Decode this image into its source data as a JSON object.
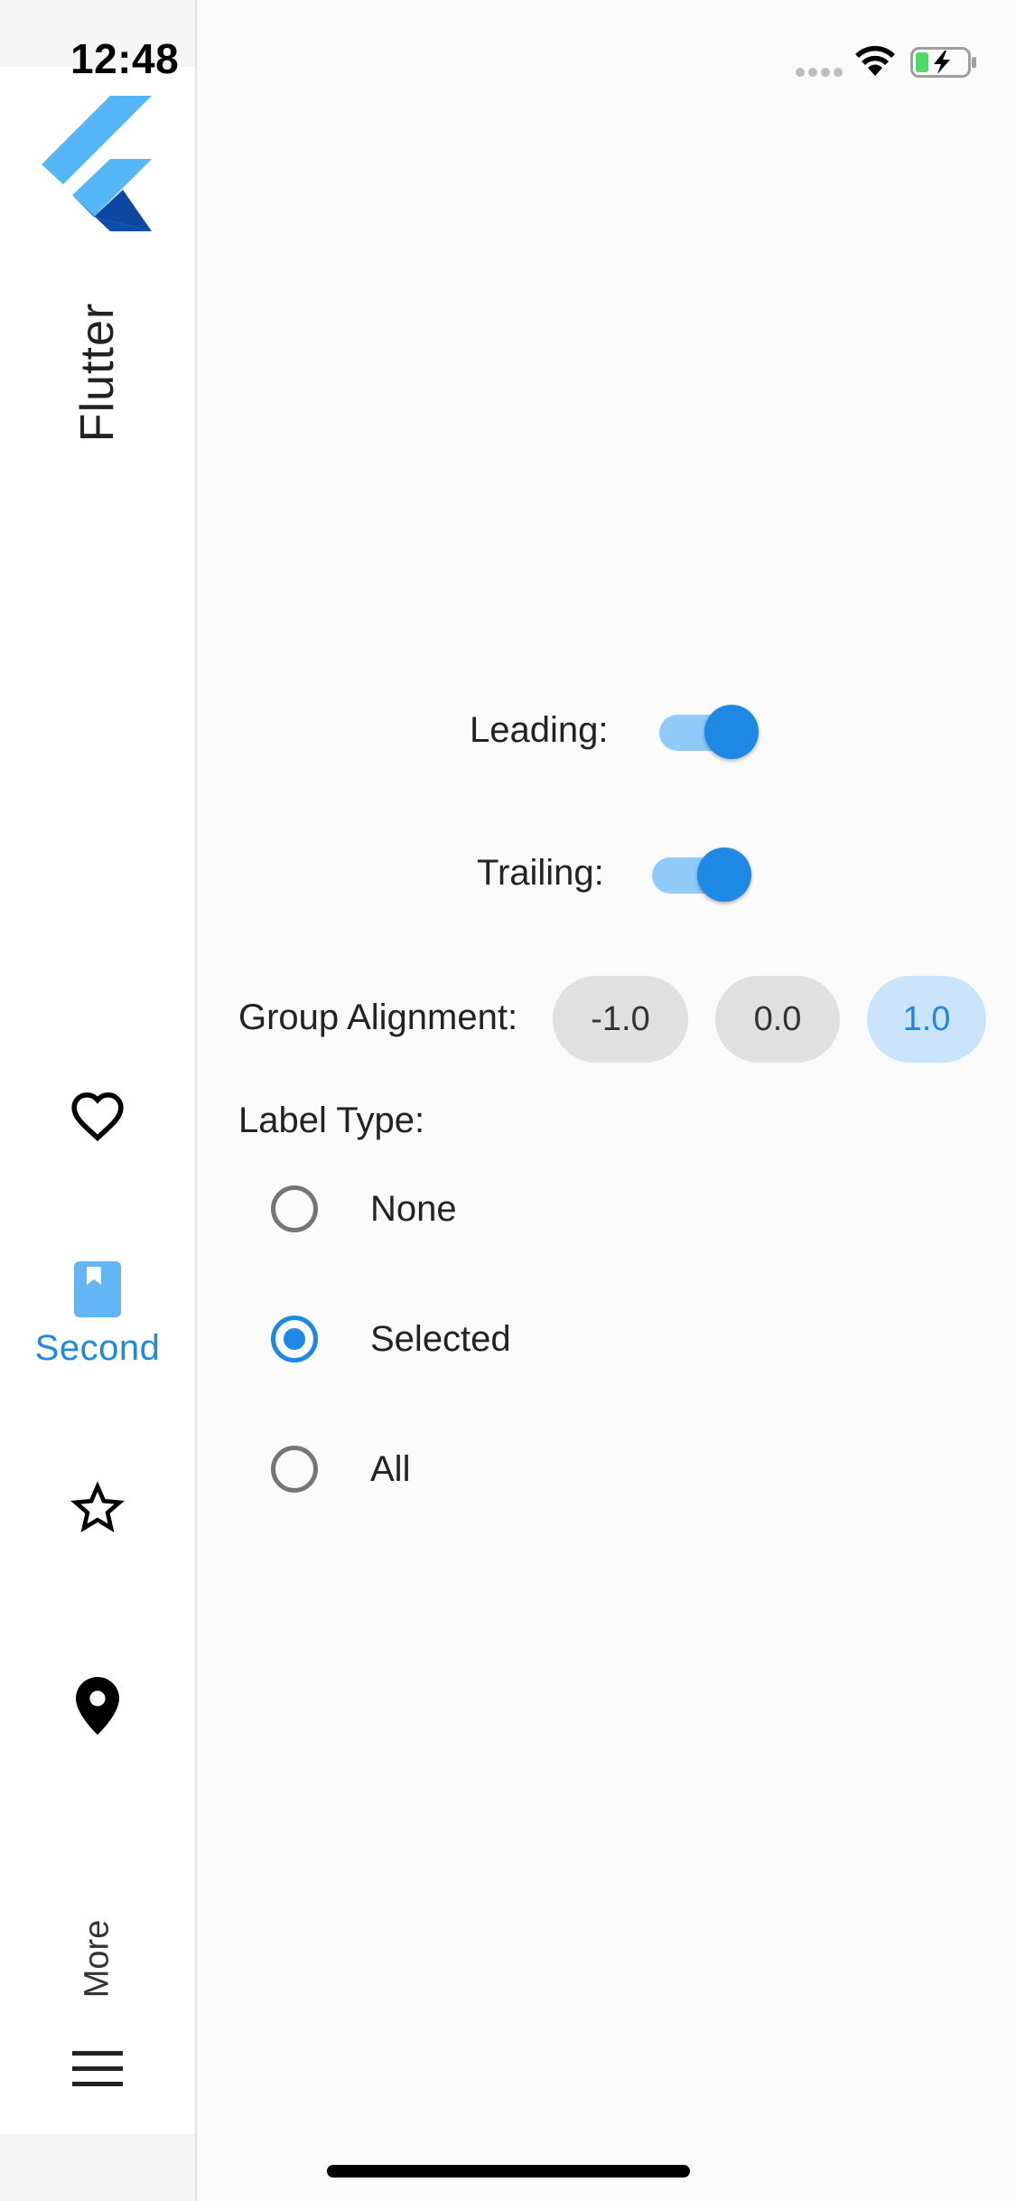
{
  "status_bar": {
    "time": "12:48"
  },
  "nav_rail": {
    "title": "Flutter",
    "destinations": [
      {
        "icon": "heart-outline-icon",
        "label": "",
        "selected": false
      },
      {
        "icon": "bookmark-icon",
        "label": "Second",
        "selected": true
      },
      {
        "icon": "star-outline-icon",
        "label": "",
        "selected": false
      },
      {
        "icon": "location-pin-icon",
        "label": "",
        "selected": false
      }
    ],
    "more_label": "More",
    "selected_color": "#1e88e5"
  },
  "settings": {
    "leading": {
      "label": "Leading:",
      "enabled": true
    },
    "trailing": {
      "label": "Trailing:",
      "enabled": true
    },
    "group_alignment": {
      "label": "Group Alignment:",
      "options": [
        "-1.0",
        "0.0",
        "1.0"
      ],
      "selected": "1.0"
    },
    "label_type": {
      "label": "Label Type:",
      "options": [
        "None",
        "Selected",
        "All"
      ],
      "selected": "Selected"
    }
  },
  "colors": {
    "accent": "#1e88e5",
    "accent_light": "#90caf9",
    "chip_bg": "#e0e0e0",
    "chip_selected_bg": "#c9e3fb"
  }
}
